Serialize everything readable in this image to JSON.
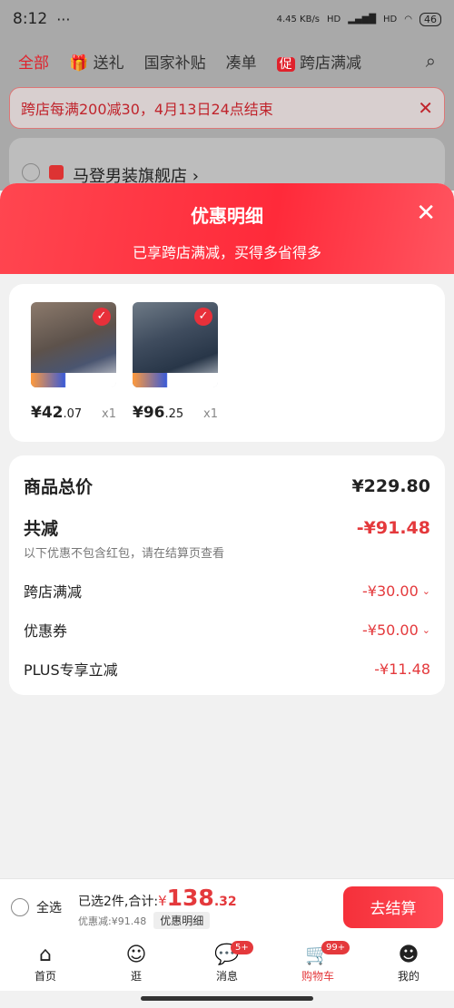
{
  "status": {
    "time": "8:12",
    "dots": "···",
    "net": "4.45 KB/s",
    "signal1": "HD",
    "signal2": "HD",
    "battery": "46"
  },
  "topnav": {
    "items": [
      "全部",
      "送礼",
      "国家补贴",
      "凑单",
      "跨店满减"
    ]
  },
  "promo": {
    "text": "跨店每满200减30，4月13日24点结束"
  },
  "store": {
    "name": "马登男装旗舰店 ›"
  },
  "sheet": {
    "title": "优惠明细",
    "subtitle": "已享跨店满减，买得多省得多"
  },
  "products": [
    {
      "price_int": "¥42",
      "price_dec": ".07",
      "qty": "x1"
    },
    {
      "price_int": "¥96",
      "price_dec": ".25",
      "qty": "x1"
    }
  ],
  "detail": {
    "total_label": "商品总价",
    "total_value": "¥229.80",
    "reduce_label": "共减",
    "reduce_value": "-¥91.48",
    "note": "以下优惠不包含红包，请在结算页查看",
    "cross_label": "跨店满减",
    "cross_value": "-¥30.00",
    "coupon_label": "优惠券",
    "coupon_value": "-¥50.00",
    "plus_label": "PLUS专享立减",
    "plus_value": "-¥11.48"
  },
  "footer": {
    "select_all": "全选",
    "selected_text": "已选2件,合计:",
    "yen": "¥",
    "amount_int": "138",
    "amount_dec": ".32",
    "discount_text": "优惠减:¥91.48",
    "detail_tag": "优惠明细",
    "checkout": "去结算"
  },
  "tabbar": [
    {
      "label": "首页"
    },
    {
      "label": "逛"
    },
    {
      "label": "消息",
      "badge": "5+"
    },
    {
      "label": "购物车",
      "badge": "99+"
    },
    {
      "label": "我的"
    }
  ],
  "colors": {
    "accent": "#e4393c"
  }
}
